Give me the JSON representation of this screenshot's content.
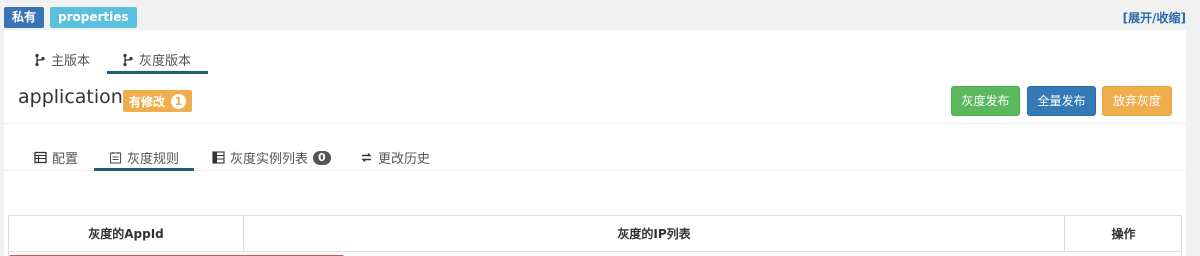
{
  "top": {
    "private_badge": "私有",
    "format_badge": "properties",
    "toggle_link": "[展开/收缩]"
  },
  "version_tabs": [
    {
      "label": "主版本",
      "icon": "branch-icon",
      "active": false
    },
    {
      "label": "灰度版本",
      "icon": "branch-icon",
      "active": true
    }
  ],
  "namespace": {
    "name": "application",
    "modified_label": "有修改",
    "modified_count": "1"
  },
  "actions": {
    "gray_release": "灰度发布",
    "full_release": "全量发布",
    "abandon_gray": "放弃灰度"
  },
  "sub_tabs": [
    {
      "label": "配置",
      "icon": "table-icon",
      "active": false
    },
    {
      "label": "灰度规则",
      "icon": "calendar-icon",
      "active": true
    },
    {
      "label": "灰度实例列表",
      "icon": "list-icon",
      "count": "0",
      "active": false
    },
    {
      "label": "更改历史",
      "icon": "swap-icon",
      "active": false
    }
  ],
  "rules_table": {
    "columns": [
      "灰度的AppId",
      "灰度的IP列表",
      "操作"
    ]
  },
  "colors": {
    "green": "#5cb85c",
    "blue": "#337ab7",
    "orange": "#f0ad4e",
    "tab_accent": "#1f5f73",
    "red": "#d9534f"
  }
}
